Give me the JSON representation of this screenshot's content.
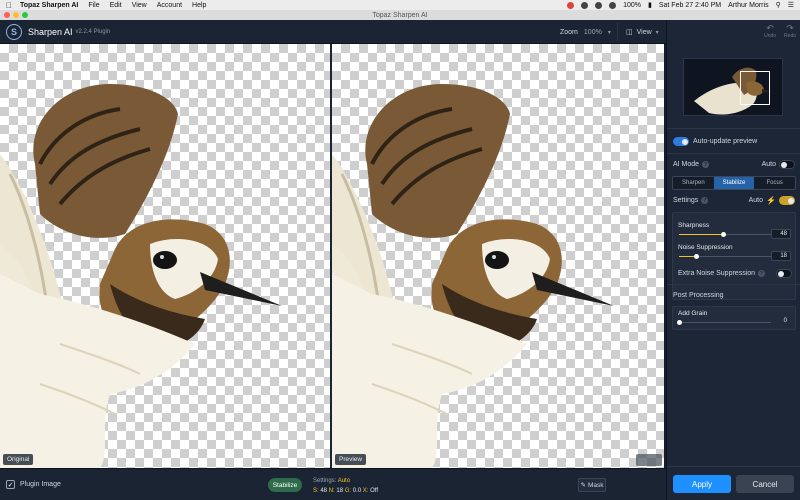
{
  "menubar": {
    "app": "Topaz Sharpen AI",
    "items": [
      "File",
      "Edit",
      "View",
      "Account",
      "Help"
    ],
    "battery": "100%",
    "datetime": "Sat Feb 27  2:40 PM",
    "user": "Arthur Morris"
  },
  "window": {
    "title": "Topaz Sharpen AI"
  },
  "header": {
    "app_name": "Sharpen AI",
    "version": "v2.2.4 Plugin",
    "zoom_label": "Zoom",
    "zoom_value": "100%",
    "view_label": "View"
  },
  "panes": {
    "left_label": "Original",
    "right_label": "Preview"
  },
  "bottom": {
    "plugin_label": "Plugin Image",
    "mode": "Stabilize",
    "settings_label": "Settings:",
    "settings_value": "Auto",
    "s_label": "S:",
    "s_value": "48",
    "n_label": "N:",
    "n_value": "18",
    "g_label": "G:",
    "g_value": "0.0",
    "x_label": "X:",
    "x_value": "Off",
    "mask_label": "Mask"
  },
  "panel": {
    "undo": "Undo",
    "redo": "Redo",
    "auto_update": "Auto-update preview",
    "ai_mode": "AI Mode",
    "auto": "Auto",
    "tabs": [
      "Sharpen",
      "Stabilize",
      "Focus"
    ],
    "active_tab": "Stabilize",
    "settings": "Settings",
    "settings_auto": "Auto",
    "sharpness_label": "Sharpness",
    "sharpness_value": "48",
    "sharpness_level": 0.48,
    "noise_label": "Noise Suppression",
    "noise_value": "18",
    "noise_level": 0.18,
    "extra_noise_label": "Extra Noise Suppression",
    "post_processing": "Post Processing",
    "grain_label": "Add Grain",
    "grain_value": "0",
    "grain_level": 0,
    "apply": "Apply",
    "cancel": "Cancel"
  },
  "colors": {
    "accent": "#1e90ff",
    "active_tab": "#2563a8",
    "stabilize": "#2e6b4a",
    "highlight": "#f2c12e"
  }
}
